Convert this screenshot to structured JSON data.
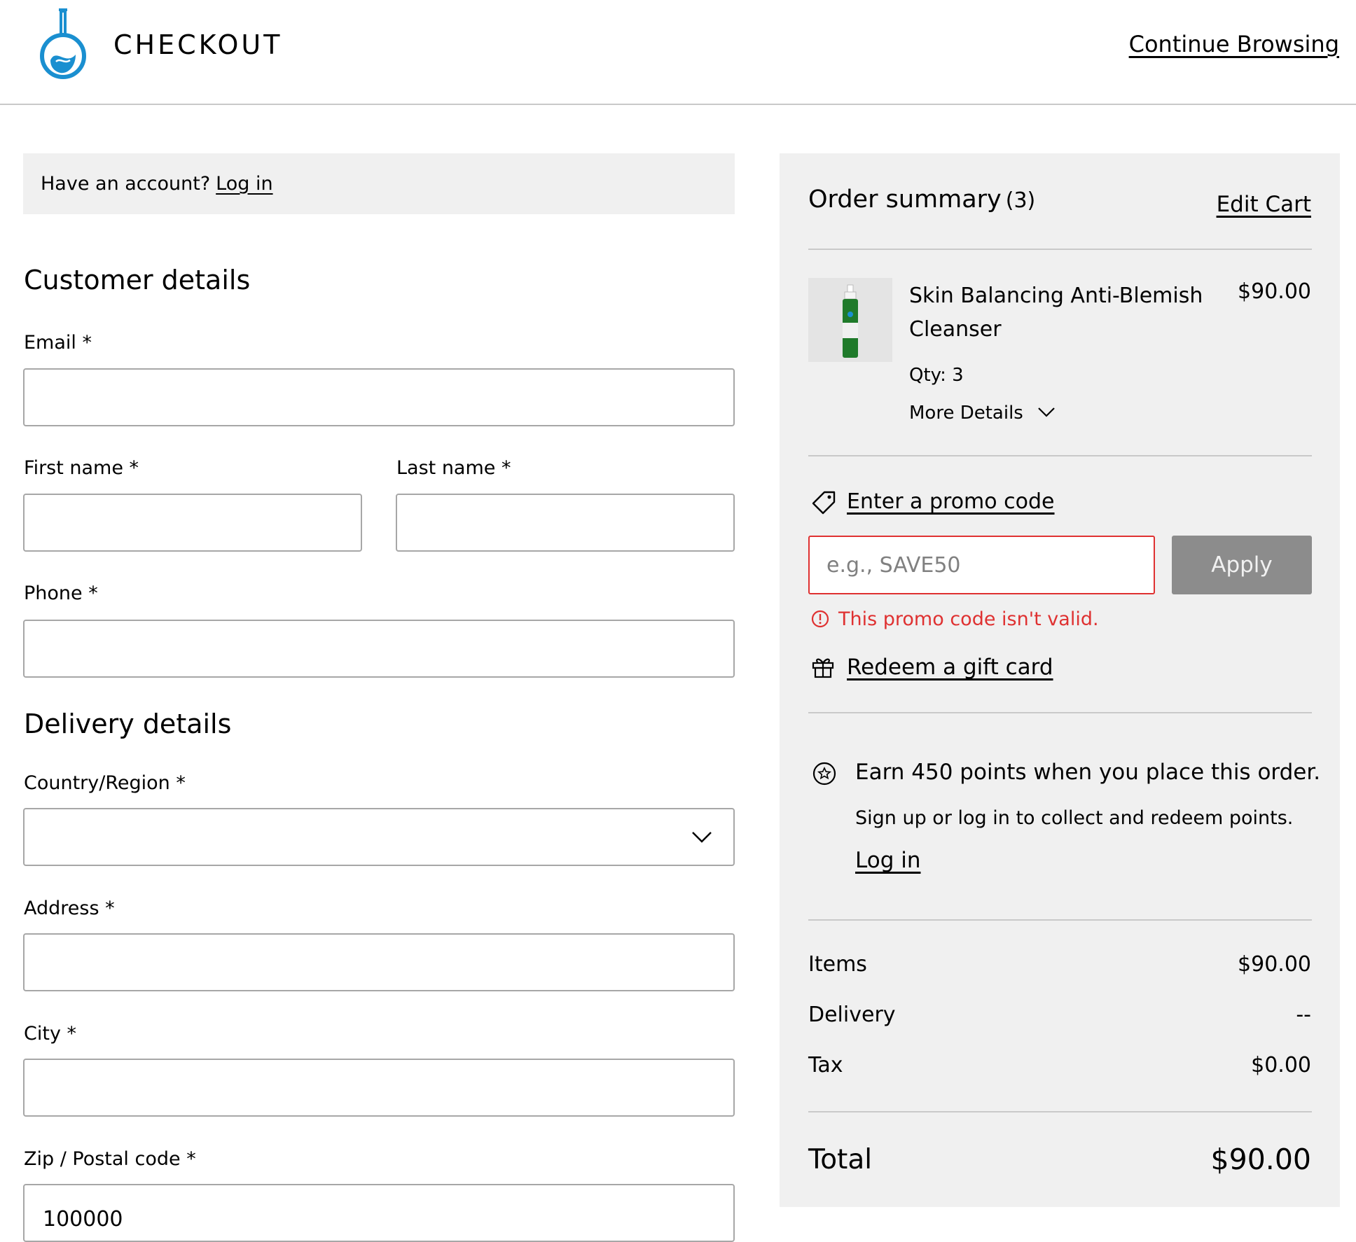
{
  "header": {
    "brand": "CHECKOUT",
    "continue_label": "Continue Browsing",
    "logo_icon": "flask-logo-icon",
    "accent_color": "#1a8fd0"
  },
  "account": {
    "prompt": "Have an account?",
    "login_label": "Log in"
  },
  "customer": {
    "title": "Customer details",
    "email_label": "Email *",
    "email_value": "",
    "first_name_label": "First name *",
    "first_name_value": "",
    "last_name_label": "Last name *",
    "last_name_value": "",
    "phone_label": "Phone *",
    "phone_value": ""
  },
  "delivery": {
    "title": "Delivery details",
    "country_label": "Country/Region *",
    "country_value": "",
    "address_label": "Address *",
    "address_value": "",
    "city_label": "City *",
    "city_value": "",
    "zip_label": "Zip / Postal code *",
    "zip_value": "100000"
  },
  "summary": {
    "title": "Order summary",
    "count": "(3)",
    "edit_cart_label": "Edit Cart",
    "item": {
      "name": "Skin Balancing Anti-Blemish Cleanser",
      "price": "$90.00",
      "qty": "Qty: 3",
      "more_details": "More Details"
    },
    "promo": {
      "link_label": "Enter a promo code",
      "placeholder": "e.g., SAVE50",
      "value": "",
      "apply_label": "Apply",
      "error": "This promo code isn't valid.",
      "error_color": "#df3131"
    },
    "gift_card_label": "Redeem a gift card",
    "points": {
      "main": "Earn 450 points when you place this order.",
      "sub": "Sign up or log in to collect and redeem points.",
      "login_label": "Log in"
    },
    "totals": {
      "items_label": "Items",
      "items_value": "$90.00",
      "delivery_label": "Delivery",
      "delivery_value": "--",
      "tax_label": "Tax",
      "tax_value": "$0.00",
      "total_label": "Total",
      "total_value": "$90.00"
    }
  }
}
